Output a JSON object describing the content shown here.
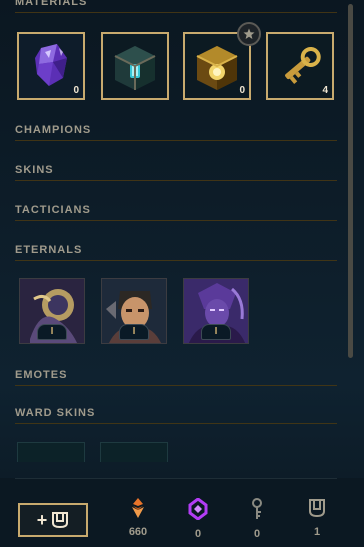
{
  "sections": {
    "materials": "MATERIALS",
    "champions": "CHAMPIONS",
    "skins": "SKINS",
    "tacticians": "TACTICIANS",
    "eternals": "ETERNALS",
    "emotes": "EMOTES",
    "ward_skins": "WARD SKINS"
  },
  "materials": [
    {
      "icon": "gemstone-icon",
      "count": "0"
    },
    {
      "icon": "hextech-chest-icon",
      "count": ""
    },
    {
      "icon": "masterwork-chest-icon",
      "count": "0"
    },
    {
      "icon": "key-icon",
      "count": "4"
    }
  ],
  "eternals": [
    {
      "icon": "eternal-series-1-icon",
      "rank": "I"
    },
    {
      "icon": "eternal-series-2-icon",
      "rank": "I"
    },
    {
      "icon": "eternal-series-3-icon",
      "rank": "I"
    }
  ],
  "footer": {
    "add_label": "+",
    "currencies": [
      {
        "icon": "orange-essence-icon",
        "value": "660",
        "color": "#e8742a"
      },
      {
        "icon": "mythic-essence-icon",
        "value": "0",
        "color": "#b33cf5"
      },
      {
        "icon": "key-fragment-icon",
        "value": "0",
        "color": "#8a8a82"
      },
      {
        "icon": "chest-icon",
        "value": "1",
        "color": "#a09b8c"
      }
    ]
  }
}
